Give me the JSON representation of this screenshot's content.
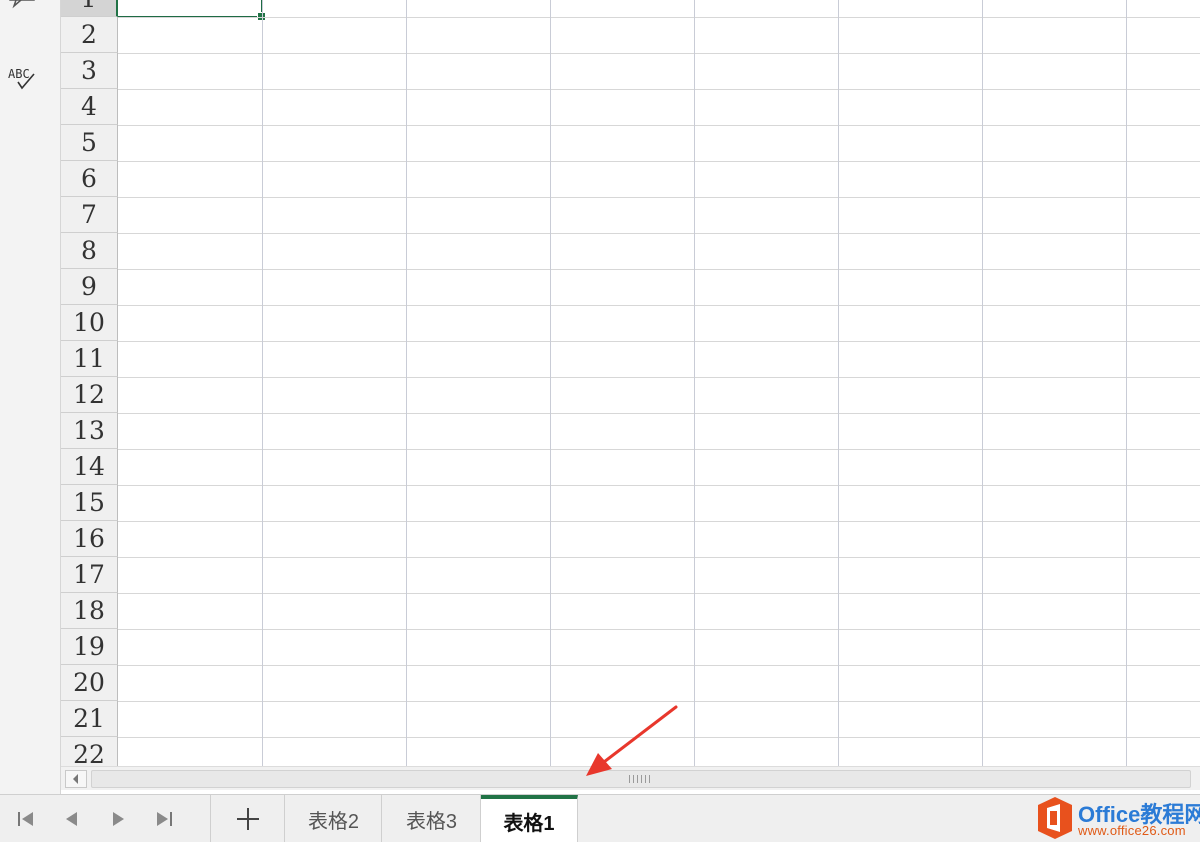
{
  "left_strip": {
    "icons": [
      "comment-icon",
      "spell-check-icon"
    ],
    "spell_label": "ABC"
  },
  "grid": {
    "rows": [
      "1",
      "2",
      "3",
      "4",
      "5",
      "6",
      "7",
      "8",
      "9",
      "10",
      "11",
      "12",
      "13",
      "14",
      "15",
      "16",
      "17",
      "18",
      "19",
      "20",
      "21",
      "22"
    ],
    "selected_row": "1",
    "visible_columns": 8
  },
  "tabbar": {
    "nav_icons": [
      "first-sheet-icon",
      "prev-sheet-icon",
      "next-sheet-icon",
      "last-sheet-icon"
    ],
    "add_label": "+",
    "tabs": [
      {
        "label": "表格2",
        "active": false
      },
      {
        "label": "表格3",
        "active": false
      },
      {
        "label": "表格1",
        "active": true
      }
    ]
  },
  "watermark": {
    "title": "Office",
    "title_cn": "教程网",
    "url": "www.office26.com"
  },
  "colors": {
    "accent": "#217346",
    "annotation": "#e8372c",
    "logo_orange": "#e8511d",
    "logo_blue": "#2b7bd6"
  }
}
